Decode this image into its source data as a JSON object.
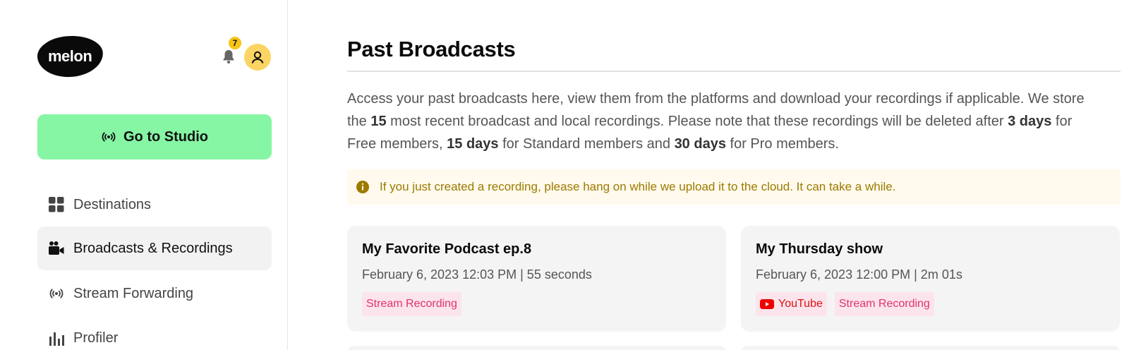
{
  "app": {
    "logo_text": "melon",
    "notification_count": "7",
    "accent_color": "#86f5a4",
    "badge_color": "#f5c518"
  },
  "sidebar": {
    "studio_button": {
      "label": "Go to Studio",
      "icon": "broadcast-icon"
    },
    "items": [
      {
        "label": "Destinations",
        "icon": "grid-icon",
        "active": false
      },
      {
        "label": "Broadcasts & Recordings",
        "icon": "video-camera-icon",
        "active": true
      },
      {
        "label": "Stream Forwarding",
        "icon": "broadcast-icon",
        "active": false
      },
      {
        "label": "Profiler",
        "icon": "bar-chart-icon",
        "active": false
      }
    ]
  },
  "main": {
    "title": "Past Broadcasts",
    "description": {
      "p1": "Access your past broadcasts here, view them from the platforms and download your recordings if applicable. We store the ",
      "b1": "15",
      "p2": " most recent broadcast and local recordings. Please note that these recordings will be deleted after ",
      "b2": "3 days",
      "p3": " for Free members, ",
      "b3": "15 days",
      "p4": " for Standard members and ",
      "b4": "30 days",
      "p5": " for Pro members."
    },
    "notice": "If you just created a recording, please hang on while we upload it to the cloud. It can take a while.",
    "cards": [
      {
        "title": "My Favorite Podcast ep.8",
        "meta": "February 6, 2023 12:03 PM | 55 seconds",
        "tags": [
          "Stream Recording"
        ]
      },
      {
        "title": "My Thursday show",
        "meta": "February 6, 2023 12:00 PM | 2m 01s",
        "youtube_tag": "YouTube",
        "tags": [
          "Stream Recording"
        ]
      }
    ]
  }
}
